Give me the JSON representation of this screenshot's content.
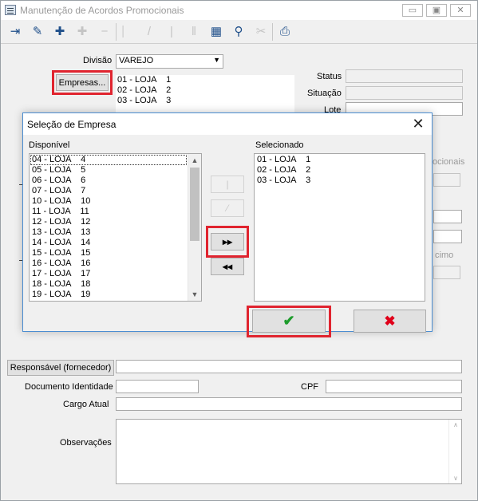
{
  "window": {
    "title": "Manutenção de Acordos Promocionais",
    "minimize": "▭",
    "maximize": "▣",
    "close": "✕"
  },
  "toolbar": {
    "icons": [
      "exit-icon",
      "edit-icon",
      "add-icon",
      "add-disabled-icon",
      "remove-disabled-icon",
      "first-icon",
      "prev-icon",
      "next-icon",
      "last-icon",
      "grid-icon",
      "search-icon",
      "cut-icon",
      "print-icon"
    ]
  },
  "form": {
    "divisao_label": "Divisão",
    "divisao_value": "VAREJO",
    "empresas_button": "Empresas...",
    "empresas_list": [
      "01 - LOJA    1",
      "02 - LOJA    2",
      "03 - LOJA    3"
    ],
    "status_label": "Status",
    "situacao_label": "Situação",
    "lote_label": "Lote",
    "partial_label_1": "ocionais",
    "partial_label_2": "cimo",
    "responsavel_button": "Responsável (fornecedor)",
    "documento_label": "Documento Identidade",
    "cpf_label": "CPF",
    "cargo_label": "Cargo Atual",
    "observacoes_label": "Observações"
  },
  "dialog": {
    "title": "Seleção de Empresa",
    "close": "✕",
    "available_label": "Disponível",
    "available": [
      "04 - LOJA    4",
      "05 - LOJA    5",
      "06 - LOJA    6",
      "07 - LOJA    7",
      "10 - LOJA    10",
      "11 - LOJA    11",
      "12 - LOJA    12",
      "13 - LOJA    13",
      "14 - LOJA    14",
      "15 - LOJA    15",
      "16 - LOJA    16",
      "17 - LOJA    17",
      "18 - LOJA    18",
      "19 - LOJA    19"
    ],
    "selected_label": "Selecionado",
    "selected": [
      "01 - LOJA    1",
      "02 - LOJA    2",
      "03 - LOJA    3"
    ],
    "move_one_right": "|",
    "move_one_left": "⁄",
    "move_all_right": "▸▸",
    "move_all_left": "◂◂",
    "confirm": "✔",
    "cancel": "✖",
    "colors": {
      "confirm": "#1e9c2c",
      "cancel": "#e0001a",
      "highlight": "#e0242f"
    }
  }
}
